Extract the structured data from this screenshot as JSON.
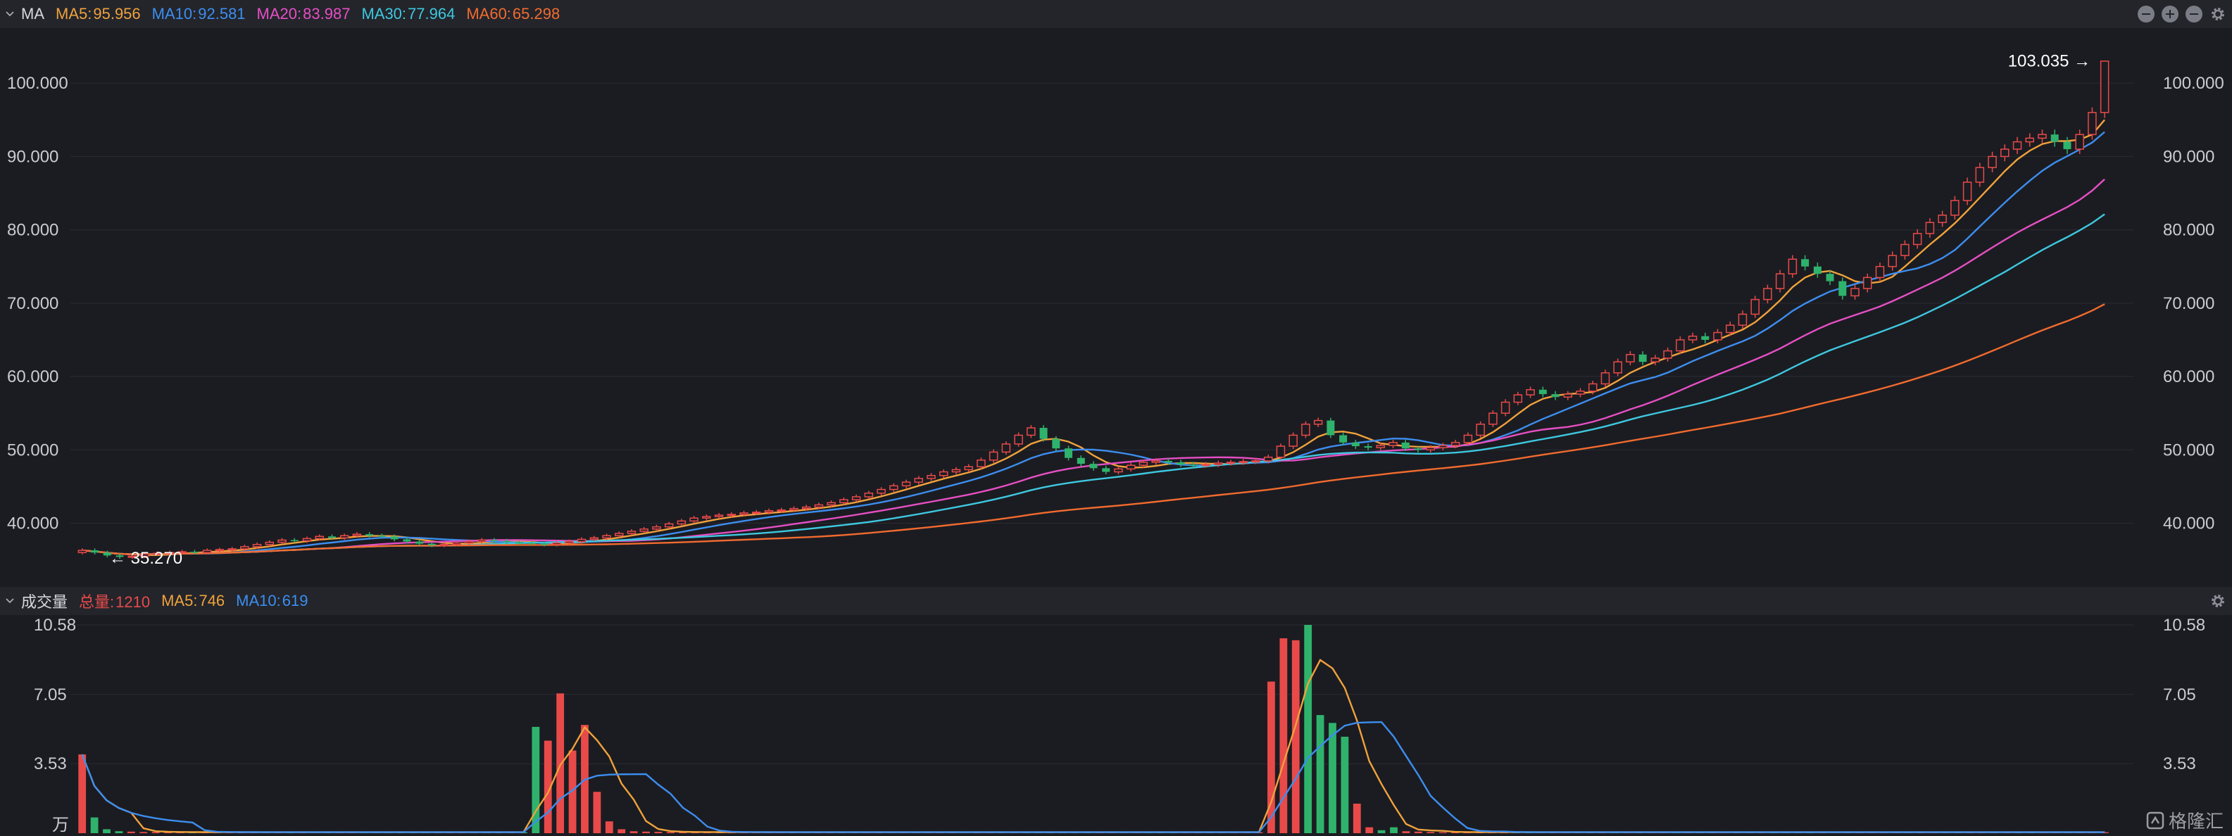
{
  "price_panel": {
    "label": "MA",
    "ma": [
      {
        "label": "MA5:",
        "value": "95.956",
        "color": "#f0a23c"
      },
      {
        "label": "MA10:",
        "value": "92.581",
        "color": "#3d8ef0"
      },
      {
        "label": "MA20:",
        "value": "83.987",
        "color": "#e64fc4"
      },
      {
        "label": "MA30:",
        "value": "77.964",
        "color": "#3ec8e0"
      },
      {
        "label": "MA60:",
        "value": "65.298",
        "color": "#f26b2f"
      }
    ]
  },
  "volume_panel": {
    "label": "成交量",
    "items": [
      {
        "label": "总量:",
        "value": "1210",
        "color": "#e84a4a"
      },
      {
        "label": "MA5:",
        "value": "746",
        "color": "#f0a23c"
      },
      {
        "label": "MA10:",
        "value": "619",
        "color": "#3d8ef0"
      }
    ],
    "unit": "万"
  },
  "icons": {
    "collapse": "chevron-down-icon",
    "zoom_out": "minus-circle-icon",
    "zoom_in": "plus-circle-icon",
    "minimize": "minus-circle-icon",
    "settings": "gear-icon"
  },
  "watermark": "格隆汇",
  "chart_data": [
    {
      "type": "candlestick",
      "y_ticks": [
        "100.000",
        "90.000",
        "80.000",
        "70.000",
        "60.000",
        "50.000",
        "40.000"
      ],
      "y_tick_values": [
        100,
        90,
        80,
        70,
        60,
        50,
        40
      ],
      "ylim": [
        31.7,
        107.5
      ],
      "high_label": "103.035",
      "low_label": "35.270",
      "colors": {
        "up": "#e84a4a",
        "down": "#2fb36c"
      },
      "close": [
        36.3,
        36.0,
        35.6,
        35.4,
        35.5,
        35.8,
        35.9,
        36.0,
        36.1,
        36.0,
        36.3,
        36.4,
        36.5,
        36.8,
        37.1,
        37.4,
        37.7,
        37.6,
        37.9,
        38.2,
        38.0,
        38.3,
        38.5,
        38.3,
        38.2,
        37.8,
        37.5,
        37.2,
        37.0,
        37.1,
        37.3,
        37.5,
        37.7,
        37.6,
        37.4,
        37.3,
        37.2,
        37.1,
        37.3,
        37.5,
        37.8,
        38.0,
        38.3,
        38.6,
        38.9,
        39.2,
        39.5,
        39.9,
        40.3,
        40.7,
        40.9,
        41.1,
        41.2,
        41.4,
        41.5,
        41.7,
        41.8,
        42.0,
        42.2,
        42.5,
        42.8,
        43.2,
        43.6,
        44.1,
        44.6,
        45.1,
        45.6,
        46.1,
        46.5,
        47.0,
        47.3,
        47.7,
        48.6,
        49.7,
        50.8,
        52.0,
        53.0,
        51.5,
        50.2,
        48.9,
        48.1,
        47.5,
        47.0,
        47.4,
        47.9,
        48.3,
        48.5,
        48.3,
        48.0,
        47.9,
        48.0,
        48.2,
        48.3,
        48.4,
        48.5,
        49.0,
        50.5,
        52.0,
        53.5,
        54.0,
        52.0,
        51.0,
        50.5,
        50.3,
        50.6,
        51.0,
        50.2,
        50.0,
        50.3,
        50.6,
        51.0,
        52.0,
        53.5,
        55.0,
        56.5,
        57.5,
        58.2,
        57.6,
        57.2,
        57.6,
        58.0,
        59.0,
        60.5,
        62.0,
        63.0,
        62.0,
        62.5,
        63.5,
        65.0,
        65.5,
        65.0,
        66.0,
        67.0,
        68.5,
        70.5,
        72.0,
        74.0,
        76.0,
        75.0,
        74.0,
        73.0,
        71.0,
        72.0,
        73.5,
        75.0,
        76.5,
        78.0,
        79.5,
        81.0,
        82.0,
        84.0,
        86.5,
        88.5,
        90.0,
        91.0,
        92.0,
        92.5,
        93.0,
        92.0,
        91.0,
        93.0,
        96.0,
        103.0
      ]
    },
    {
      "type": "bar",
      "y_ticks": [
        "10.58",
        "7.05",
        "3.53"
      ],
      "y_tick_values": [
        10.58,
        7.05,
        3.53
      ],
      "ylim": [
        0,
        10.58
      ],
      "colors": {
        "up": "#e84a4a",
        "down": "#2fb36c"
      },
      "volume": [
        4.0,
        0.8,
        0.2,
        0.1,
        0.08,
        0.06,
        0.06,
        0.05,
        0.05,
        0.05,
        0.05,
        0.05,
        0.05,
        0.05,
        0.05,
        0.05,
        0.05,
        0.05,
        0.05,
        0.05,
        0.05,
        0.05,
        0.05,
        0.05,
        0.05,
        0.05,
        0.05,
        0.05,
        0.05,
        0.05,
        0.05,
        0.05,
        0.05,
        0.05,
        0.05,
        0.05,
        0.05,
        5.4,
        4.7,
        7.1,
        4.2,
        5.5,
        2.1,
        0.6,
        0.2,
        0.1,
        0.08,
        0.07,
        0.06,
        0.05,
        0.05,
        0.05,
        0.05,
        0.05,
        0.05,
        0.05,
        0.05,
        0.05,
        0.05,
        0.05,
        0.05,
        0.05,
        0.05,
        0.05,
        0.05,
        0.05,
        0.05,
        0.05,
        0.05,
        0.05,
        0.05,
        0.05,
        0.05,
        0.05,
        0.05,
        0.05,
        0.05,
        0.05,
        0.05,
        0.05,
        0.05,
        0.05,
        0.05,
        0.05,
        0.05,
        0.05,
        0.05,
        0.05,
        0.05,
        0.05,
        0.05,
        0.05,
        0.05,
        0.05,
        0.05,
        0.05,
        0.05,
        7.7,
        9.9,
        9.8,
        10.58,
        6.0,
        5.6,
        4.9,
        1.5,
        0.3,
        0.15,
        0.3,
        0.1,
        0.08,
        0.06,
        0.05,
        0.05,
        0.05,
        0.05,
        0.05,
        0.05,
        0.05,
        0.05,
        0.05,
        0.05,
        0.05,
        0.05,
        0.05,
        0.05,
        0.05,
        0.05,
        0.05,
        0.05,
        0.05,
        0.05,
        0.05,
        0.05,
        0.05,
        0.05,
        0.05,
        0.05,
        0.05,
        0.05,
        0.05,
        0.05,
        0.05,
        0.05,
        0.05,
        0.05,
        0.05,
        0.05,
        0.05,
        0.05,
        0.05,
        0.05,
        0.05,
        0.05,
        0.05,
        0.05,
        0.05,
        0.05,
        0.05,
        0.05,
        0.05,
        0.05,
        0.05,
        0.05,
        0.05,
        0.05,
        0.05
      ],
      "series": [
        {
          "name": "MA5",
          "color": "#f0a23c"
        },
        {
          "name": "MA10",
          "color": "#3d8ef0"
        }
      ]
    }
  ]
}
